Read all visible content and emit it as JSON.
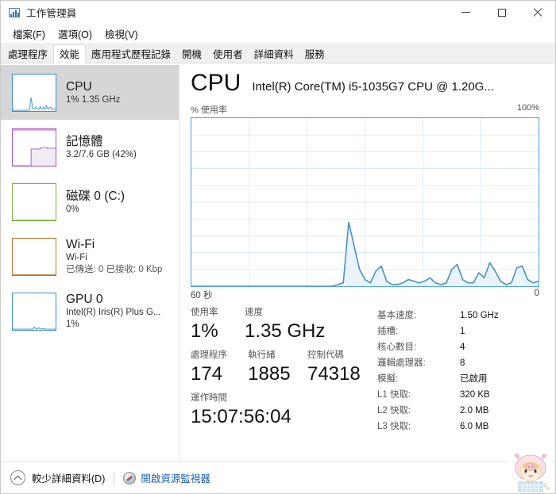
{
  "window": {
    "title": "工作管理員",
    "icon": "task-manager-icon",
    "controls": {
      "minimize": "—",
      "maximize": "□",
      "close": "×"
    }
  },
  "menu": [
    {
      "label": "檔案(F)"
    },
    {
      "label": "選項(O)"
    },
    {
      "label": "檢視(V)"
    }
  ],
  "tabs": [
    {
      "label": "處理程序",
      "active": false
    },
    {
      "label": "效能",
      "active": true
    },
    {
      "label": "應用程式歷程記錄",
      "active": false
    },
    {
      "label": "開機",
      "active": false
    },
    {
      "label": "使用者",
      "active": false
    },
    {
      "label": "詳細資料",
      "active": false
    },
    {
      "label": "服務",
      "active": false
    }
  ],
  "sidebar": {
    "items": [
      {
        "name": "cpu",
        "title": "CPU",
        "sub1": "1%  1.35 GHz",
        "sub2": "",
        "color": "#3a8fd0",
        "selected": true
      },
      {
        "name": "memory",
        "title": "記憶體",
        "sub1": "3.2/7.6 GB (42%)",
        "sub2": "",
        "color": "#a34fc4",
        "selected": false
      },
      {
        "name": "disk",
        "title": "磁碟 0 (C:)",
        "sub1": "0%",
        "sub2": "",
        "color": "#7cb342",
        "selected": false
      },
      {
        "name": "wifi",
        "title": "Wi-Fi",
        "sub1": "Wi-Fi",
        "sub2": "已傳送: 0 已接收: 0 Kbp",
        "color": "#c1722c",
        "selected": false
      },
      {
        "name": "gpu",
        "title": "GPU 0",
        "sub1": "Intel(R) Iris(R) Plus G...",
        "sub2": "1%",
        "color": "#3a8fd0",
        "selected": false
      }
    ]
  },
  "main": {
    "heading": "CPU",
    "model": "Intel(R) Core(TM) i5-1035G7 CPU @ 1.20G...",
    "graph_axis_top_left": "% 使用率",
    "graph_axis_top_right": "100%",
    "graph_axis_bottom_left": "60 秒",
    "graph_axis_bottom_right": "0",
    "stats": {
      "utilization_label": "使用率",
      "utilization_value": "1%",
      "speed_label": "速度",
      "speed_value": "1.35 GHz",
      "processes_label": "處理程序",
      "processes_value": "174",
      "threads_label": "執行緒",
      "threads_value": "1885",
      "handles_label": "控制代碼",
      "handles_value": "74318",
      "uptime_label": "運作時間",
      "uptime_value": "15:07:56:04"
    },
    "specs": [
      {
        "label": "基本速度:",
        "value": "1.50 GHz"
      },
      {
        "label": "插槽:",
        "value": "1"
      },
      {
        "label": "核心數目:",
        "value": "4"
      },
      {
        "label": "邏輯處理器:",
        "value": "8"
      },
      {
        "label": "模擬:",
        "value": "已啟用"
      },
      {
        "label": "L1 快取:",
        "value": "320 KB"
      },
      {
        "label": "L2 快取:",
        "value": "2.0 MB"
      },
      {
        "label": "L3 快取:",
        "value": "6.0 MB"
      }
    ]
  },
  "statusbar": {
    "chevron_icon": "chevron-up-icon",
    "fewer_details": "較少詳細資料(D)",
    "resource_monitor_icon": "resource-monitor-icon",
    "resource_monitor_link": "開啟資源監視器"
  },
  "colors": {
    "accent": "#4f9fd8",
    "graph_line": "#4a90c4",
    "graph_fill": "#eaf3fa",
    "grid": "#cfe3f2",
    "link": "#1a5fb4",
    "selected_bg": "#d6d6d6"
  },
  "chart_data": {
    "type": "area",
    "title": "% 使用率",
    "xlabel": "60 秒",
    "ylabel": "% 使用率",
    "ylim": [
      0,
      100
    ],
    "xlim": [
      60,
      0
    ],
    "grid": true,
    "grid_cols": 6,
    "grid_rows": 10,
    "legend": "none",
    "x": [
      60,
      59,
      58,
      57,
      56,
      55,
      54,
      53,
      52,
      51,
      50,
      49,
      48,
      47,
      46,
      45,
      44,
      43,
      42,
      41,
      40,
      39,
      38,
      37,
      36,
      35,
      34,
      33,
      32,
      31,
      30,
      29,
      28,
      27,
      26,
      25,
      24,
      23,
      22,
      21,
      20,
      19,
      18,
      17,
      16,
      15,
      14,
      13,
      12,
      11,
      10,
      9,
      8,
      7,
      6,
      5,
      4,
      3,
      2,
      1,
      0
    ],
    "values": [
      0,
      0,
      0,
      0,
      0,
      0,
      0,
      0,
      0,
      0,
      0,
      0,
      0,
      0,
      0,
      0,
      0,
      0,
      0,
      0,
      0,
      0,
      0,
      0,
      0,
      0,
      0,
      1,
      2,
      38,
      24,
      10,
      4,
      2,
      9,
      12,
      3,
      1,
      1,
      2,
      4,
      3,
      2,
      3,
      5,
      2,
      1,
      2,
      10,
      13,
      4,
      2,
      2,
      8,
      5,
      14,
      9,
      3,
      1,
      2,
      11,
      12,
      4,
      2,
      3
    ],
    "series": [
      {
        "name": "CPU 使用率",
        "color": "#4a90c4",
        "fill": "#eaf3fa"
      }
    ]
  }
}
